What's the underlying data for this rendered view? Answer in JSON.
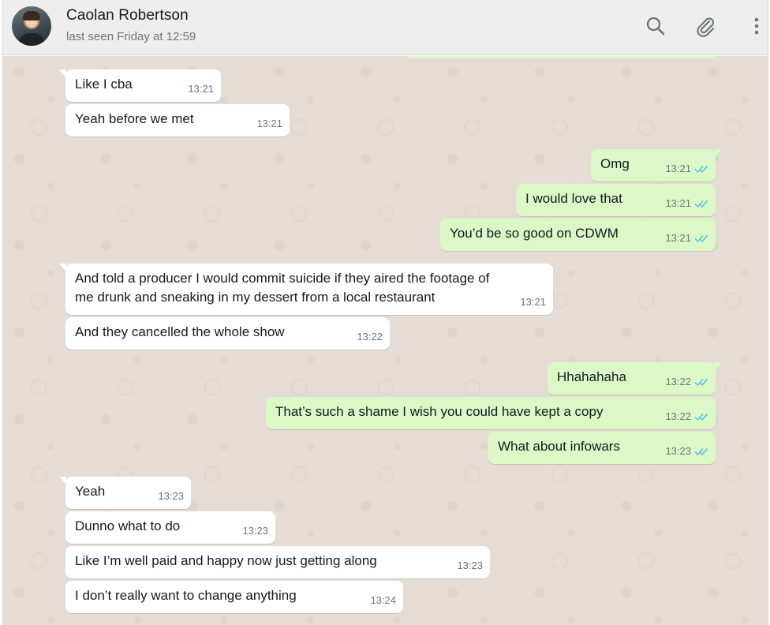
{
  "header": {
    "contact_name": "Caolan Robertson",
    "last_seen": "last seen Friday at 12:59",
    "icons": [
      "search-icon",
      "attach-icon",
      "menu-icon"
    ]
  },
  "colors": {
    "incoming_bubble": "#ffffff",
    "outgoing_bubble": "#dcf8c6",
    "read_tick": "#53bdeb",
    "chat_background": "#e5ddd5",
    "header_background": "#eeeeee"
  },
  "messages": [
    {
      "dir": "in",
      "text": "Like I cba",
      "time": "13:21"
    },
    {
      "dir": "in",
      "text": "Yeah before we met",
      "time": "13:21"
    },
    {
      "dir": "out",
      "text": "Omg",
      "time": "13:21",
      "status": "read"
    },
    {
      "dir": "out",
      "text": "I would love that",
      "time": "13:21",
      "status": "read"
    },
    {
      "dir": "out",
      "text": "You’d be so good on CDWM",
      "time": "13:21",
      "status": "read"
    },
    {
      "dir": "in",
      "text": "And told a producer I would commit suicide if they aired the footage of",
      "text2": "me drunk and sneaking in my dessert from a local restaurant",
      "time": "13:21"
    },
    {
      "dir": "in",
      "text": "And they cancelled the whole show",
      "time": "13:22"
    },
    {
      "dir": "out",
      "text": "Hhahahaha",
      "time": "13:22",
      "status": "read"
    },
    {
      "dir": "out",
      "text": "That’s such a shame I wish you could have kept a copy",
      "time": "13:22",
      "status": "read"
    },
    {
      "dir": "out",
      "text": "What about infowars",
      "time": "13:23",
      "status": "read"
    },
    {
      "dir": "in",
      "text": "Yeah",
      "time": "13:23"
    },
    {
      "dir": "in",
      "text": "Dunno what to do",
      "time": "13:23"
    },
    {
      "dir": "in",
      "text": "Like I’m well paid and happy now just getting along",
      "time": "13:23"
    },
    {
      "dir": "in",
      "text": "I don’t really want to change anything",
      "time": "13:24"
    }
  ]
}
